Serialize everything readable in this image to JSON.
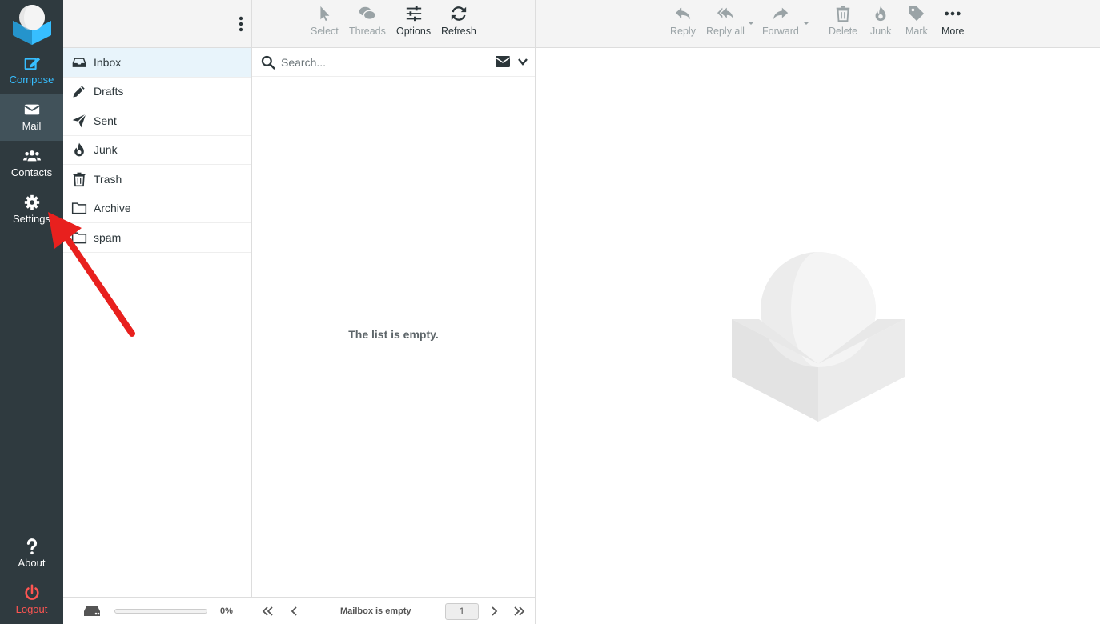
{
  "nav": {
    "compose": "Compose",
    "mail": "Mail",
    "contacts": "Contacts",
    "settings": "Settings",
    "about": "About",
    "logout": "Logout"
  },
  "folders": [
    {
      "label": "Inbox",
      "icon": "inbox-icon"
    },
    {
      "label": "Drafts",
      "icon": "pencil-icon"
    },
    {
      "label": "Sent",
      "icon": "paper-plane-icon"
    },
    {
      "label": "Junk",
      "icon": "fire-icon"
    },
    {
      "label": "Trash",
      "icon": "trash-icon"
    },
    {
      "label": "Archive",
      "icon": "folder-icon"
    },
    {
      "label": "spam",
      "icon": "folder-icon"
    }
  ],
  "quota": {
    "percent_label": "0%",
    "used_fraction": 0
  },
  "list_toolbar": {
    "select": "Select",
    "threads": "Threads",
    "options": "Options",
    "refresh": "Refresh"
  },
  "search": {
    "placeholder": "Search..."
  },
  "list": {
    "empty_message": "The list is empty."
  },
  "pager": {
    "status": "Mailbox is empty",
    "page": "1"
  },
  "message_toolbar": {
    "reply": "Reply",
    "reply_all": "Reply all",
    "forward": "Forward",
    "delete": "Delete",
    "junk": "Junk",
    "mark": "Mark",
    "more": "More"
  },
  "colors": {
    "nav_bg": "#2f3a3f",
    "accent": "#37beff",
    "logout": "#ff5552",
    "annotation_arrow": "#e8201e"
  }
}
